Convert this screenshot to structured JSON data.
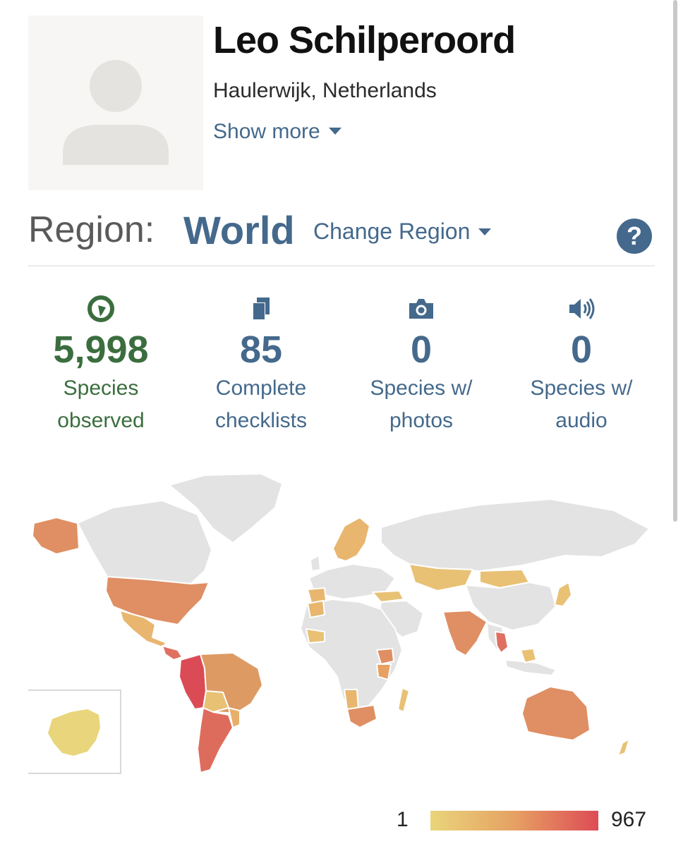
{
  "profile": {
    "name": "Leo Schilperoord",
    "location": "Haulerwijk, Netherlands",
    "show_more_label": "Show more",
    "avatar_icon": "default-user-avatar-icon"
  },
  "region": {
    "label": "Region:",
    "value": "World",
    "change_label": "Change Region",
    "help_label": "?"
  },
  "stats": [
    {
      "value": "5,998",
      "label_line1": "Species",
      "label_line2": "observed",
      "icon": "species-observed-icon",
      "color": "#3b6e3e"
    },
    {
      "value": "85",
      "label_line1": "Complete",
      "label_line2": "checklists",
      "icon": "checklist-icon",
      "color": "#44698c"
    },
    {
      "value": "0",
      "label_line1": "Species w/",
      "label_line2": "photos",
      "icon": "camera-icon",
      "color": "#44698c"
    },
    {
      "value": "0",
      "label_line1": "Species w/",
      "label_line2": "audio",
      "icon": "speaker-icon",
      "color": "#44698c"
    }
  ],
  "map": {
    "legend_min": "1",
    "legend_max": "967",
    "scale_colors": [
      "#e9d57b",
      "#e6a163",
      "#de4b55"
    ],
    "unvisited_color": "#e3e3e3"
  }
}
